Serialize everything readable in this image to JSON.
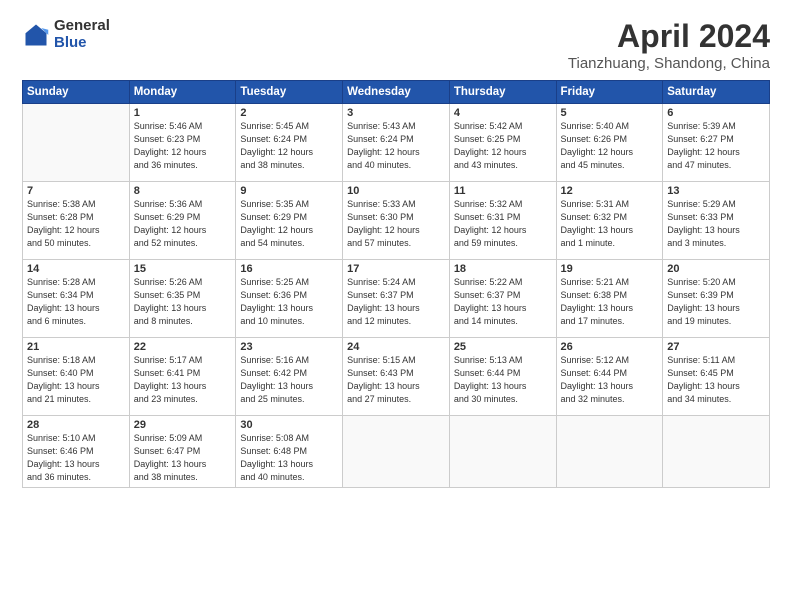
{
  "logo": {
    "general": "General",
    "blue": "Blue"
  },
  "title": "April 2024",
  "subtitle": "Tianzhuang, Shandong, China",
  "days_header": [
    "Sunday",
    "Monday",
    "Tuesday",
    "Wednesday",
    "Thursday",
    "Friday",
    "Saturday"
  ],
  "weeks": [
    [
      {
        "day": "",
        "info": ""
      },
      {
        "day": "1",
        "info": "Sunrise: 5:46 AM\nSunset: 6:23 PM\nDaylight: 12 hours\nand 36 minutes."
      },
      {
        "day": "2",
        "info": "Sunrise: 5:45 AM\nSunset: 6:24 PM\nDaylight: 12 hours\nand 38 minutes."
      },
      {
        "day": "3",
        "info": "Sunrise: 5:43 AM\nSunset: 6:24 PM\nDaylight: 12 hours\nand 40 minutes."
      },
      {
        "day": "4",
        "info": "Sunrise: 5:42 AM\nSunset: 6:25 PM\nDaylight: 12 hours\nand 43 minutes."
      },
      {
        "day": "5",
        "info": "Sunrise: 5:40 AM\nSunset: 6:26 PM\nDaylight: 12 hours\nand 45 minutes."
      },
      {
        "day": "6",
        "info": "Sunrise: 5:39 AM\nSunset: 6:27 PM\nDaylight: 12 hours\nand 47 minutes."
      }
    ],
    [
      {
        "day": "7",
        "info": "Sunrise: 5:38 AM\nSunset: 6:28 PM\nDaylight: 12 hours\nand 50 minutes."
      },
      {
        "day": "8",
        "info": "Sunrise: 5:36 AM\nSunset: 6:29 PM\nDaylight: 12 hours\nand 52 minutes."
      },
      {
        "day": "9",
        "info": "Sunrise: 5:35 AM\nSunset: 6:29 PM\nDaylight: 12 hours\nand 54 minutes."
      },
      {
        "day": "10",
        "info": "Sunrise: 5:33 AM\nSunset: 6:30 PM\nDaylight: 12 hours\nand 57 minutes."
      },
      {
        "day": "11",
        "info": "Sunrise: 5:32 AM\nSunset: 6:31 PM\nDaylight: 12 hours\nand 59 minutes."
      },
      {
        "day": "12",
        "info": "Sunrise: 5:31 AM\nSunset: 6:32 PM\nDaylight: 13 hours\nand 1 minute."
      },
      {
        "day": "13",
        "info": "Sunrise: 5:29 AM\nSunset: 6:33 PM\nDaylight: 13 hours\nand 3 minutes."
      }
    ],
    [
      {
        "day": "14",
        "info": "Sunrise: 5:28 AM\nSunset: 6:34 PM\nDaylight: 13 hours\nand 6 minutes."
      },
      {
        "day": "15",
        "info": "Sunrise: 5:26 AM\nSunset: 6:35 PM\nDaylight: 13 hours\nand 8 minutes."
      },
      {
        "day": "16",
        "info": "Sunrise: 5:25 AM\nSunset: 6:36 PM\nDaylight: 13 hours\nand 10 minutes."
      },
      {
        "day": "17",
        "info": "Sunrise: 5:24 AM\nSunset: 6:37 PM\nDaylight: 13 hours\nand 12 minutes."
      },
      {
        "day": "18",
        "info": "Sunrise: 5:22 AM\nSunset: 6:37 PM\nDaylight: 13 hours\nand 14 minutes."
      },
      {
        "day": "19",
        "info": "Sunrise: 5:21 AM\nSunset: 6:38 PM\nDaylight: 13 hours\nand 17 minutes."
      },
      {
        "day": "20",
        "info": "Sunrise: 5:20 AM\nSunset: 6:39 PM\nDaylight: 13 hours\nand 19 minutes."
      }
    ],
    [
      {
        "day": "21",
        "info": "Sunrise: 5:18 AM\nSunset: 6:40 PM\nDaylight: 13 hours\nand 21 minutes."
      },
      {
        "day": "22",
        "info": "Sunrise: 5:17 AM\nSunset: 6:41 PM\nDaylight: 13 hours\nand 23 minutes."
      },
      {
        "day": "23",
        "info": "Sunrise: 5:16 AM\nSunset: 6:42 PM\nDaylight: 13 hours\nand 25 minutes."
      },
      {
        "day": "24",
        "info": "Sunrise: 5:15 AM\nSunset: 6:43 PM\nDaylight: 13 hours\nand 27 minutes."
      },
      {
        "day": "25",
        "info": "Sunrise: 5:13 AM\nSunset: 6:44 PM\nDaylight: 13 hours\nand 30 minutes."
      },
      {
        "day": "26",
        "info": "Sunrise: 5:12 AM\nSunset: 6:44 PM\nDaylight: 13 hours\nand 32 minutes."
      },
      {
        "day": "27",
        "info": "Sunrise: 5:11 AM\nSunset: 6:45 PM\nDaylight: 13 hours\nand 34 minutes."
      }
    ],
    [
      {
        "day": "28",
        "info": "Sunrise: 5:10 AM\nSunset: 6:46 PM\nDaylight: 13 hours\nand 36 minutes."
      },
      {
        "day": "29",
        "info": "Sunrise: 5:09 AM\nSunset: 6:47 PM\nDaylight: 13 hours\nand 38 minutes."
      },
      {
        "day": "30",
        "info": "Sunrise: 5:08 AM\nSunset: 6:48 PM\nDaylight: 13 hours\nand 40 minutes."
      },
      {
        "day": "",
        "info": ""
      },
      {
        "day": "",
        "info": ""
      },
      {
        "day": "",
        "info": ""
      },
      {
        "day": "",
        "info": ""
      }
    ]
  ]
}
